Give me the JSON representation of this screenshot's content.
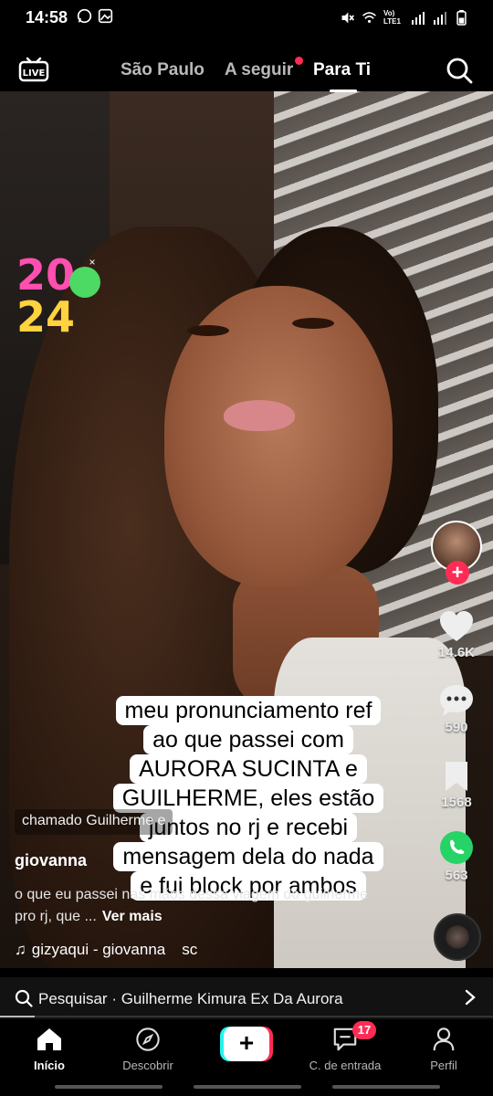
{
  "status_bar": {
    "time": "14:58",
    "left_icons": [
      "whatsapp-icon",
      "gallery-icon"
    ],
    "right_icons": [
      "mute-icon",
      "wifi-icon",
      "volte-icon",
      "signal-icon",
      "signal-icon",
      "battery-icon"
    ],
    "network_label": "Vo) LTE1"
  },
  "top_nav": {
    "live_label": "LIVE",
    "tabs": [
      {
        "label": "São Paulo"
      },
      {
        "label": "A seguir",
        "has_dot": true
      },
      {
        "label": "Para Ti",
        "active": true
      }
    ]
  },
  "sticker": {
    "line1": "20",
    "line2": "24",
    "close": "×"
  },
  "rail": {
    "likes": "14.6K",
    "comments": "590",
    "saves": "1568",
    "shares": "563",
    "follow_symbol": "+"
  },
  "caption": {
    "lines": [
      "meu pronunciamento ref",
      "ao que passei com",
      "AURORA SUCINTA e",
      "GUILHERME, eles estão",
      "juntos no rj e recebi",
      "mensagem dela do nada",
      "e fui block por ambos"
    ]
  },
  "post": {
    "tag": "chamado Guilherme e",
    "username": "giovanna",
    "description": "o que eu passei nas mãos dessa viagem do guilherme pro rj, que ...",
    "more": "Ver mais",
    "music": "gizyaqui - giovanna",
    "music_tail": "sc"
  },
  "search_suggest": {
    "text": "Pesquisar · Guilherme Kimura Ex Da Aurora",
    "progress": 0.07
  },
  "bottom_nav": {
    "items": [
      {
        "label": "Início",
        "icon": "home-icon",
        "active": true
      },
      {
        "label": "Descobrir",
        "icon": "compass-icon"
      },
      {
        "label": "",
        "icon": "plus-icon"
      },
      {
        "label": "C. de entrada",
        "icon": "inbox-icon",
        "badge": "17"
      },
      {
        "label": "Perfil",
        "icon": "profile-icon"
      }
    ],
    "create_symbol": "+"
  },
  "colors": {
    "accent": "#fe2c55",
    "cyan": "#25f4ee",
    "whatsapp": "#25d366"
  }
}
